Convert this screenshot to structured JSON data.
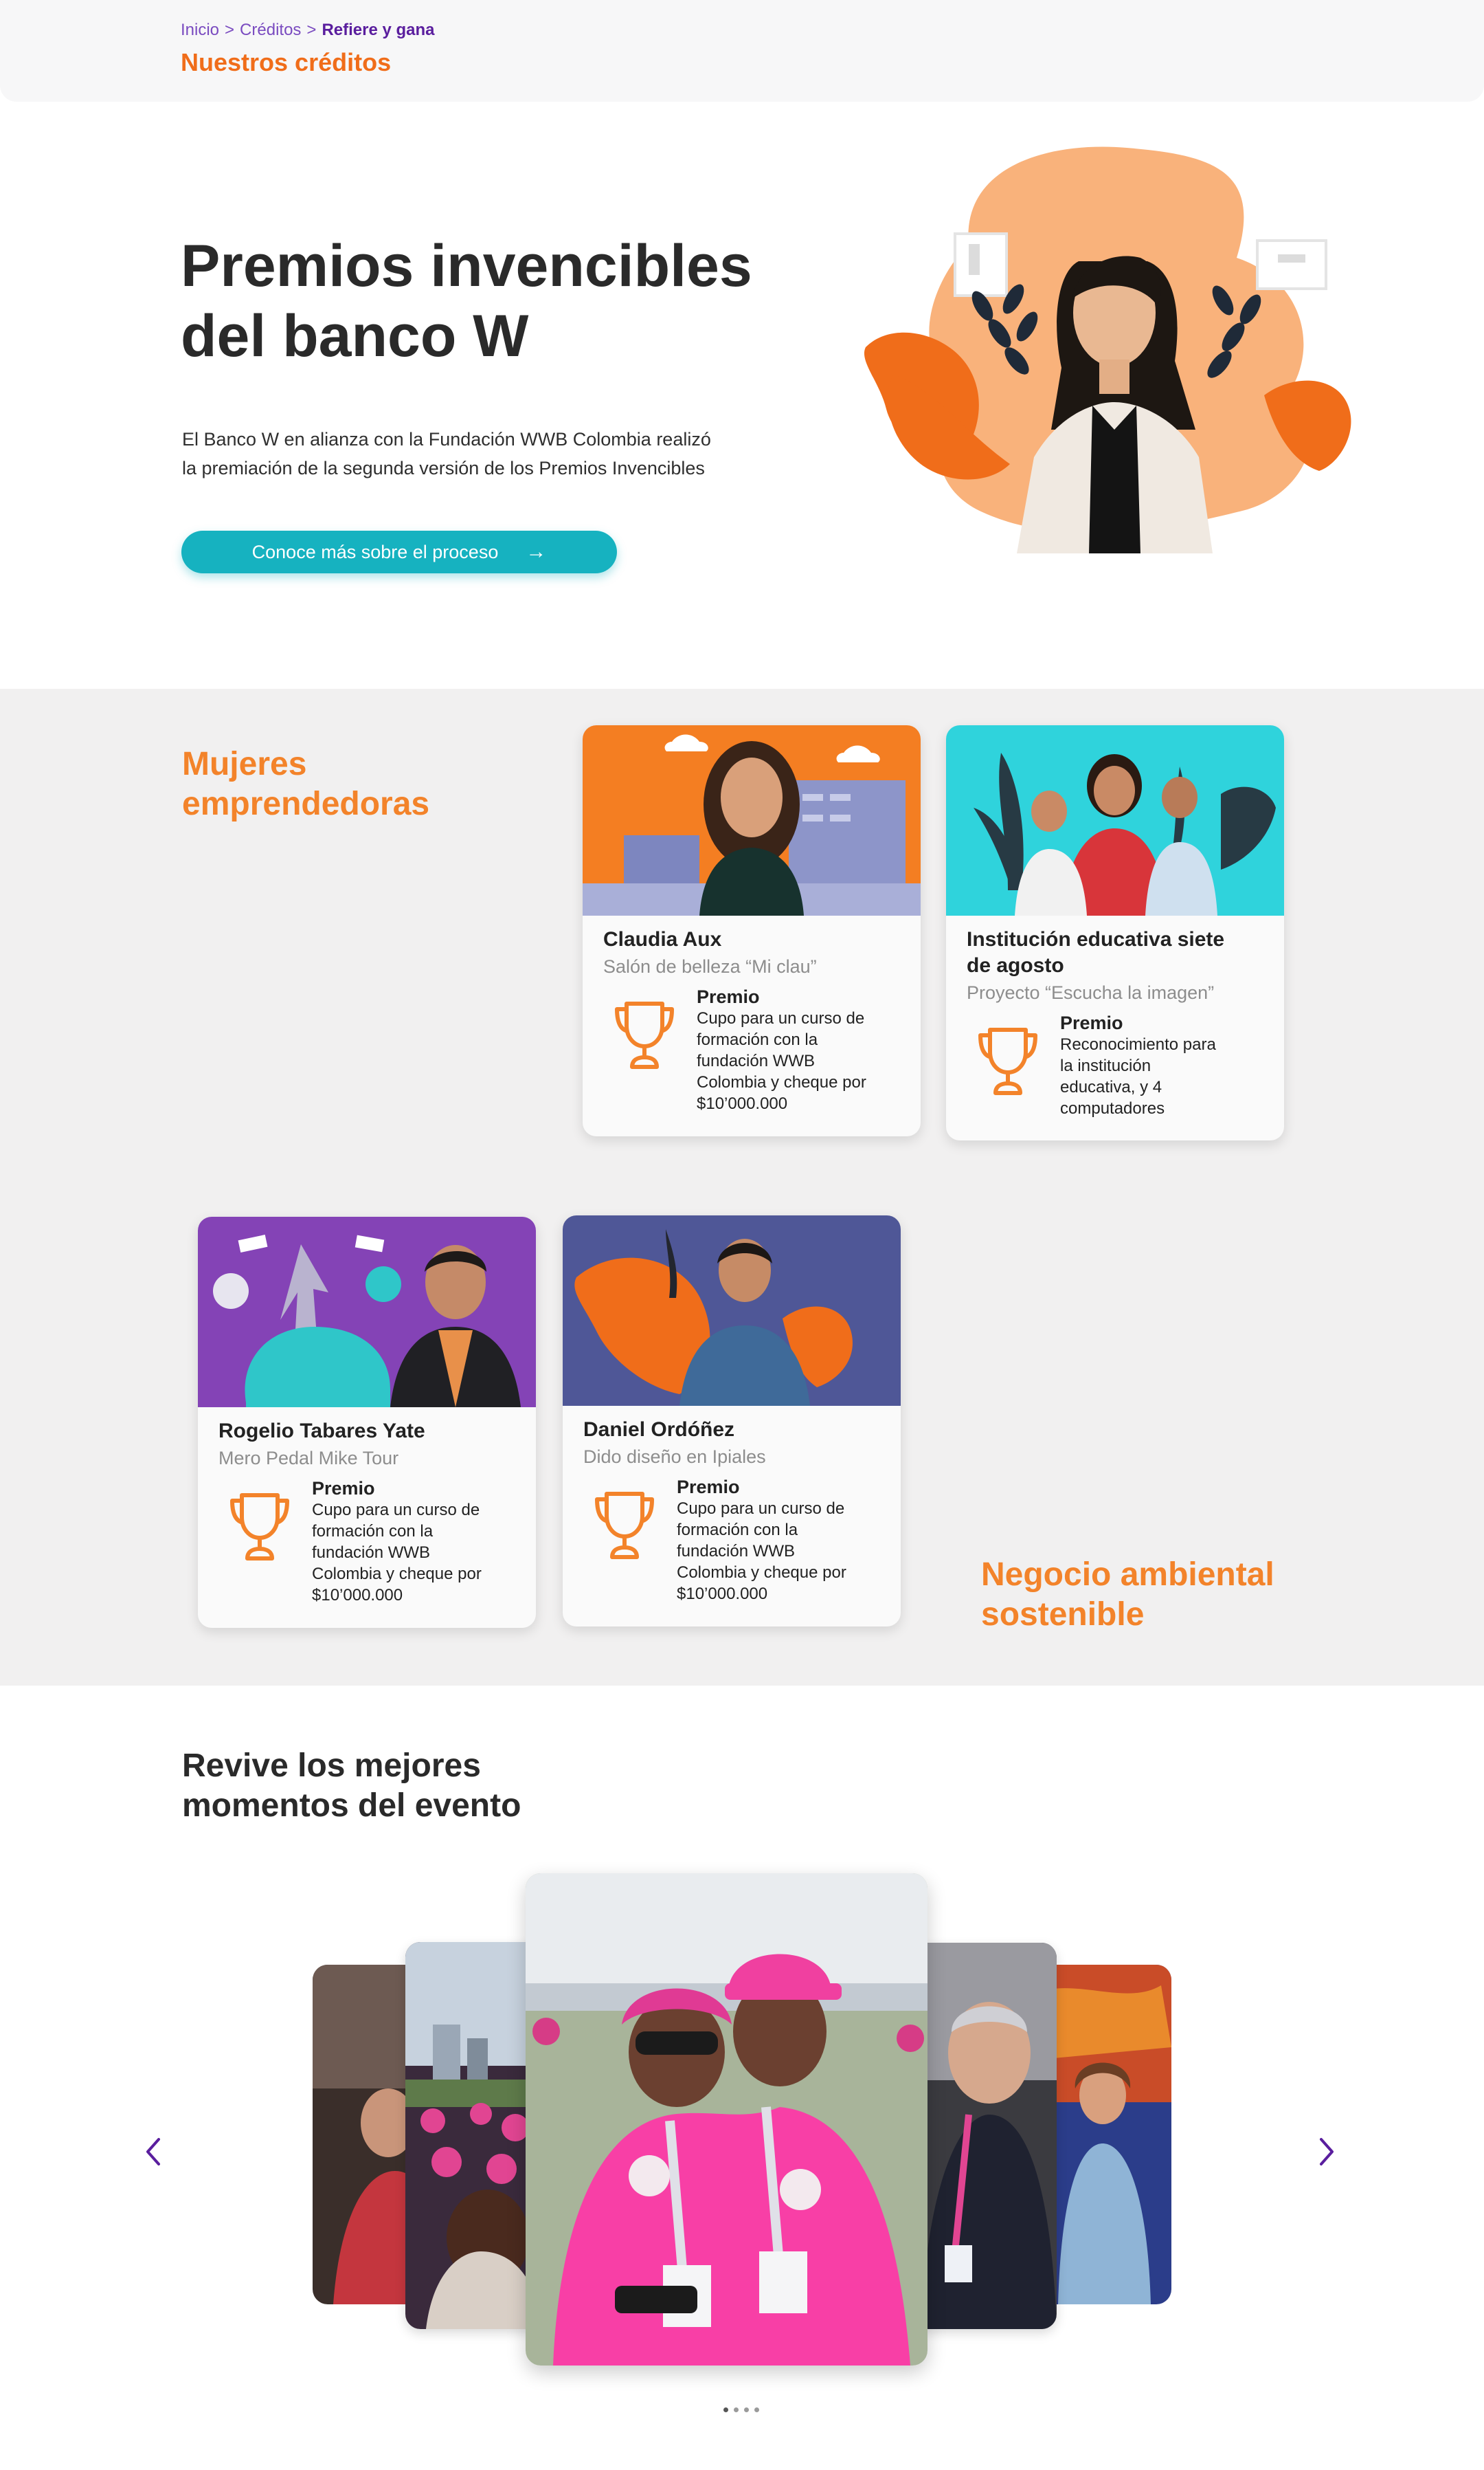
{
  "header": {
    "breadcrumb": [
      "Inicio",
      "Créditos",
      "Refiere y gana"
    ],
    "breadcrumb_separator": ">",
    "title": "Nuestros créditos"
  },
  "hero": {
    "title_line1": "Premios invencibles",
    "title_line2": "del banco W",
    "description_line1": "El Banco W en alianza con la Fundación WWB Colombia realizó",
    "description_line2": "la premiación de la segunda versión de los Premios Invencibles",
    "cta_label": "Conoce más sobre el proceso",
    "cta_icon": "arrow-right-icon"
  },
  "categories": {
    "women": {
      "line1": "Mujeres",
      "line2": "emprendedoras"
    },
    "environmental": {
      "line1": "Negocio ambiental",
      "line2": "sostenible"
    }
  },
  "cards": [
    {
      "name": "Claudia Aux",
      "project": "Salón de belleza “Mi clau”",
      "prize_title": "Premio",
      "prize_lines": [
        "Cupo para un curso de",
        "formación con la",
        "fundación WWB",
        "Colombia y cheque por",
        "$10’000.000"
      ]
    },
    {
      "name_line1": "Institución educativa siete",
      "name_line2": "de agosto",
      "project": "Proyecto “Escucha la imagen”",
      "prize_title": "Premio",
      "prize_lines": [
        "Reconocimiento para",
        "la institución",
        "educativa, y 4",
        "computadores"
      ]
    },
    {
      "name": "Rogelio Tabares Yate",
      "project": "Mero Pedal Mike Tour",
      "prize_title": "Premio",
      "prize_lines": [
        "Cupo para un curso de",
        "formación con la",
        "fundación WWB",
        "Colombia y cheque por",
        "$10’000.000"
      ]
    },
    {
      "name": "Daniel Ordóñez",
      "project": "Dido diseño en Ipiales",
      "prize_title": "Premio",
      "prize_lines": [
        "Cupo para un curso de",
        "formación con la",
        "fundación WWB",
        "Colombia y cheque por",
        "$10’000.000"
      ]
    }
  ],
  "gallery": {
    "title_line1": "Revive los mejores",
    "title_line2": "momentos del evento",
    "prev_icon": "chevron-left-icon",
    "next_icon": "chevron-right-icon",
    "slide_count": 5,
    "active_dot": 1,
    "dot_count": 4
  },
  "colors": {
    "accent_orange": "#f3832a",
    "brand_purple": "#5a1e9e",
    "teal": "#16b2c0",
    "section_bg": "#f1f0f0"
  }
}
